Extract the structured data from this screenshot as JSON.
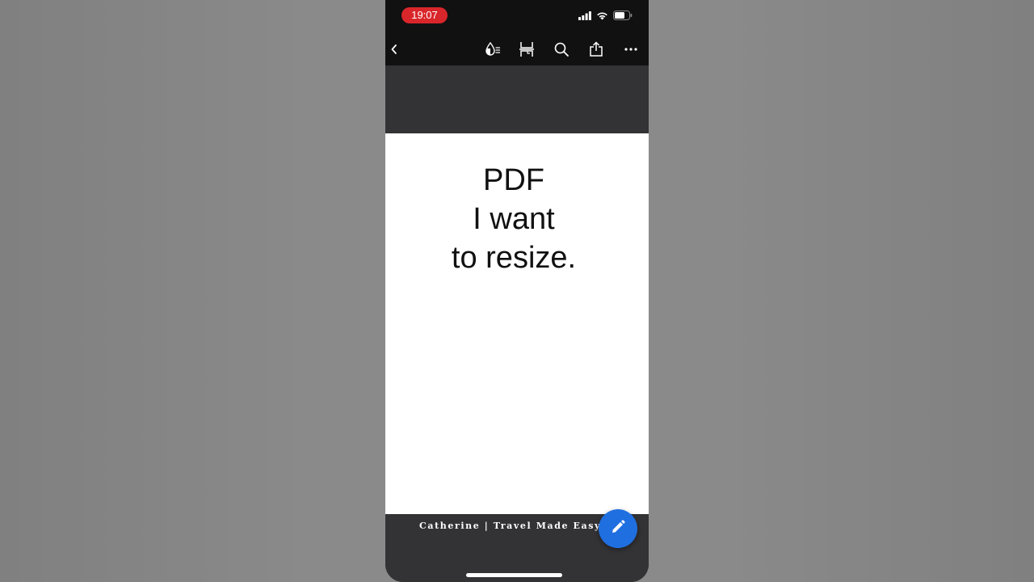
{
  "status_bar": {
    "time": "19:07",
    "time_pill_color": "#d9262b",
    "icons": [
      "cellular-signal-icon",
      "wifi-icon",
      "battery-icon"
    ]
  },
  "toolbar": {
    "icons": [
      "back-chevron-icon",
      "color-ink-icon",
      "page-layout-icon",
      "search-icon",
      "share-icon",
      "more-icon"
    ]
  },
  "document": {
    "lines": [
      "PDF",
      "I want",
      "to resize."
    ]
  },
  "watermark": {
    "text": "Catherine | Travel Made Easy"
  },
  "fab": {
    "icon": "pencil-icon",
    "color": "#1f6fe0"
  }
}
